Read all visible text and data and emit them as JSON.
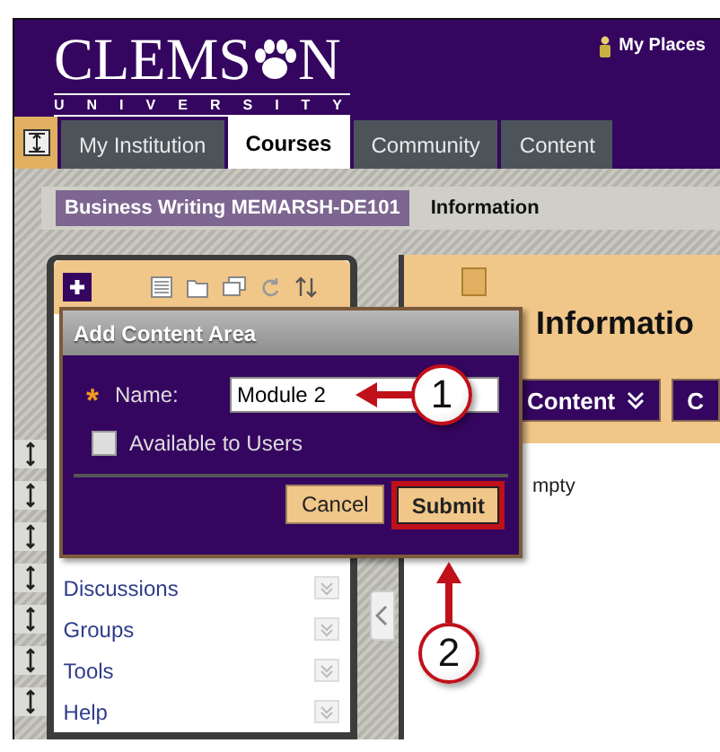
{
  "header": {
    "logo_left": "CLEMS",
    "logo_right": "N",
    "logo_subtitle": "UNIVERSITY",
    "my_places": "My Places"
  },
  "tabs": [
    {
      "label": "My Institution",
      "selected": false
    },
    {
      "label": "Courses",
      "selected": true
    },
    {
      "label": "Community",
      "selected": false
    },
    {
      "label": "Content",
      "selected": false
    }
  ],
  "breadcrumb": {
    "course": "Business Writing MEMARSH-DE101",
    "page": "Information"
  },
  "course_menu": {
    "items": [
      "Discussions",
      "Groups",
      "Tools",
      "Help"
    ]
  },
  "content": {
    "title": "Informatio",
    "buttons": [
      "Content",
      "C"
    ],
    "body_text": "mpty"
  },
  "dialog": {
    "title": "Add Content Area",
    "required_mark": "*",
    "name_label": "Name:",
    "name_value": "Module 2",
    "checkbox": {
      "label": "Available to Users",
      "checked": false
    },
    "buttons": [
      {
        "label": "Cancel",
        "highlighted": false
      },
      {
        "label": "Submit",
        "highlighted": true
      }
    ]
  },
  "callouts": [
    "1",
    "2"
  ]
}
